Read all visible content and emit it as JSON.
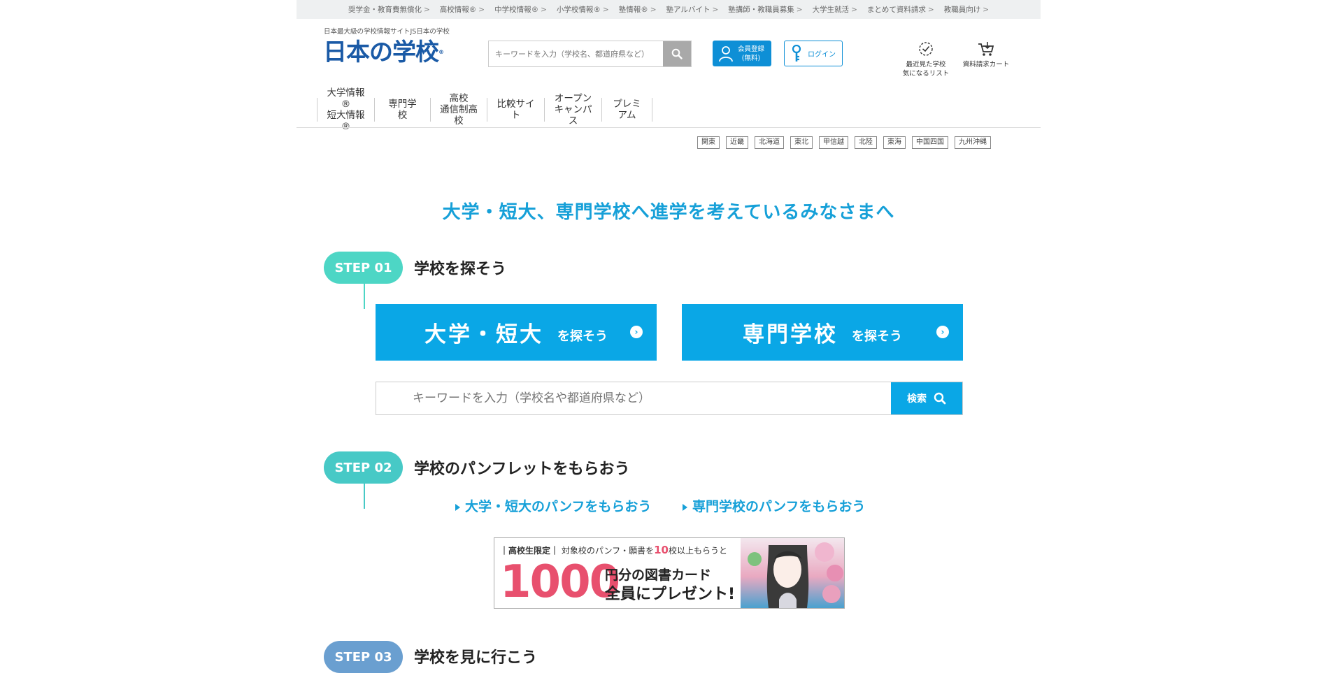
{
  "top_links": [
    "奨学金・教育費無償化",
    "高校情報®",
    "中学校情報®",
    "小学校情報®",
    "塾情報®",
    "塾アルバイト",
    "塾講師・教職員募集",
    "大学生就活",
    "まとめて資料請求",
    "教職員向け"
  ],
  "top_links_arrow": ">",
  "header": {
    "tagline": "日本最大級の学校情報サイトJS日本の学校",
    "logo_text": "日本の学校",
    "logo_reg": "®",
    "search_placeholder": "キーワードを入力（学校名、都道府県など）",
    "register_line1": "会員登録",
    "register_line2": "(無料)",
    "login_label": "ログイン",
    "recent_line1": "最近見た学校",
    "recent_line2": "気になるリスト",
    "cart_label": "資料請求カート"
  },
  "gnav": [
    {
      "line1": "大学情報®",
      "line2": "短大情報®"
    },
    {
      "line1": "専門学校",
      "line2": ""
    },
    {
      "line1": "高校",
      "line2": "通信制高校"
    },
    {
      "line1": "比較サイト",
      "line2": ""
    },
    {
      "line1": "オープン",
      "line2": "キャンパス"
    },
    {
      "line1": "プレミアム",
      "line2": ""
    }
  ],
  "regions": [
    "関東",
    "近畿",
    "北海道",
    "東北",
    "甲信越",
    "北陸",
    "東海",
    "中国四国",
    "九州沖縄"
  ],
  "main_heading": "大学・短大、専門学校へ進学を考えているみなさまへ",
  "steps": [
    {
      "label": "STEP 01",
      "title": "学校を探そう",
      "color": "#4dd6c5"
    },
    {
      "label": "STEP 02",
      "title": "学校のパンフレットをもらおう",
      "color": "#47c9c6"
    },
    {
      "label": "STEP 03",
      "title": "学校を見に行こう",
      "color": "#6a9fd0"
    }
  ],
  "search_buttons": [
    {
      "main": "大学・短大",
      "sub": "を探そう"
    },
    {
      "main": "専門学校",
      "sub": "を探そう"
    }
  ],
  "main_search": {
    "placeholder": "キーワードを入力（学校名や都道府県など）",
    "button": "検索"
  },
  "pamphlet_links": [
    "大学・短大のパンフをもらおう",
    "専門学校のパンフをもらおう"
  ],
  "banner": {
    "tag": "高校生限定",
    "text_before": "対象校のパンフ・願書を",
    "ten": "10",
    "text_after": "校以上もらうと",
    "amount": "1000",
    "line1": "円分の図書カード",
    "line2": "全員にプレゼント!"
  },
  "colors": {
    "accent": "#0aa7e6",
    "heading": "#16a0d8",
    "logo": "#1a5aa6",
    "banner_pink": "#e8506e"
  }
}
